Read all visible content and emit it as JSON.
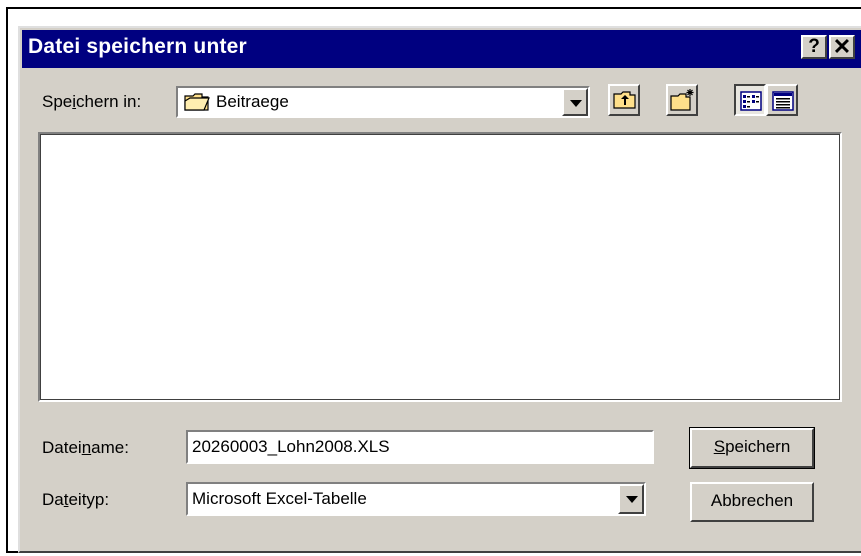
{
  "dialog": {
    "title": "Datei speichern unter",
    "help_symbol": "?",
    "close_symbol": "✕"
  },
  "location": {
    "label_pre": "Spe",
    "label_mnemonic": "i",
    "label_post": "chern in:",
    "value": "Beitraege"
  },
  "toolbar": {
    "icons": [
      "up-one-level-icon",
      "new-folder-icon",
      "list-view-icon",
      "details-view-icon"
    ]
  },
  "filename": {
    "label_pre": "Datei",
    "label_mnemonic": "n",
    "label_post": "ame:",
    "value": "20260003_Lohn2008.XLS"
  },
  "filetype": {
    "label_pre": "Da",
    "label_mnemonic": "t",
    "label_post": "eityp:",
    "value": "Microsoft Excel-Tabelle"
  },
  "buttons": {
    "save_mnemonic": "S",
    "save_rest": "peichern",
    "cancel": "Abbrechen"
  },
  "colors": {
    "titlebar": "#000080",
    "face": "#d4d0c8",
    "folder": "#ffe08a"
  }
}
